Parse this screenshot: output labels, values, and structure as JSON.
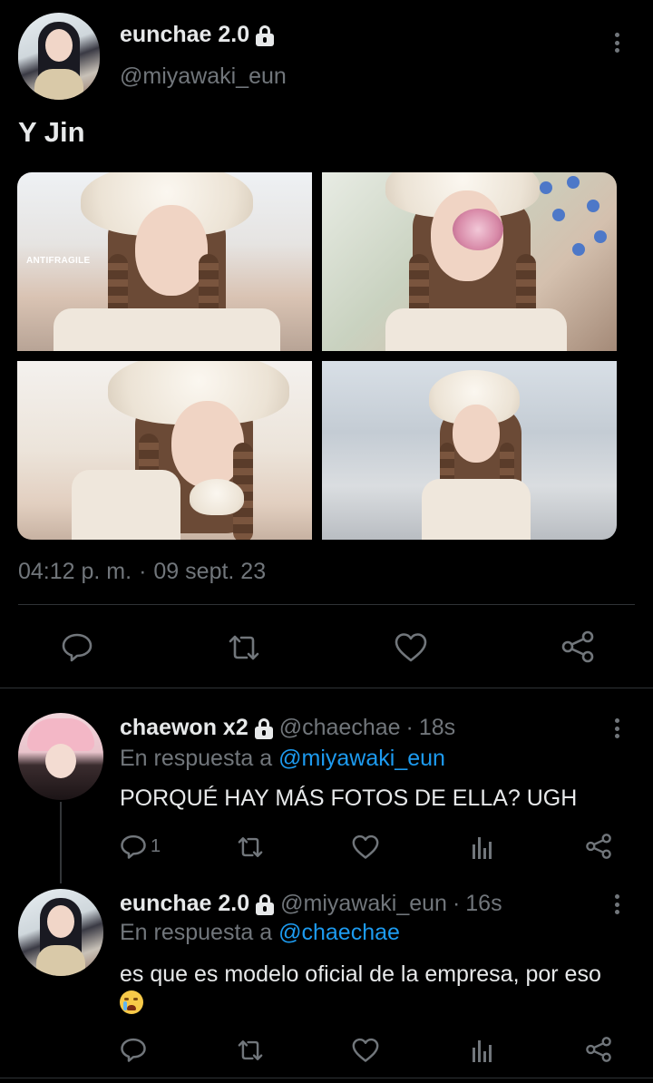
{
  "main_tweet": {
    "display_name": "eunchae 2.0",
    "handle": "@miyawaki_eun",
    "text": "Y Jin",
    "watermark": "ANTIFRAGILE",
    "time": "04:12 p. m.",
    "separator": "·",
    "date": "09 sept. 23"
  },
  "replies": [
    {
      "display_name": "chaewon x2",
      "handle": "@chaechae",
      "separator": "·",
      "time_ago": "18s",
      "reply_prefix": "En respuesta a",
      "reply_mention": "@miyawaki_eun",
      "text": "PORQUÉ HAY MÁS FOTOS DE ELLA? UGH",
      "reply_count": "1"
    },
    {
      "display_name": "eunchae 2.0",
      "handle": "@miyawaki_eun",
      "separator": "·",
      "time_ago": "16s",
      "reply_prefix": "En respuesta a",
      "reply_mention": "@chaechae",
      "text": "es que es modelo oficial de la empresa, por eso"
    }
  ],
  "icons": {
    "reply": "reply-icon",
    "retweet": "retweet-icon",
    "like": "heart-icon",
    "share": "share-icon",
    "analytics": "analytics-icon",
    "more": "more-vertical-icon",
    "lock": "lock-icon",
    "emoji": "crying-cat-emoji"
  },
  "colors": {
    "background": "#000000",
    "text": "#e7e9ea",
    "secondary": "#71767b",
    "accent": "#1d9bf0",
    "divider": "#2f3336"
  }
}
